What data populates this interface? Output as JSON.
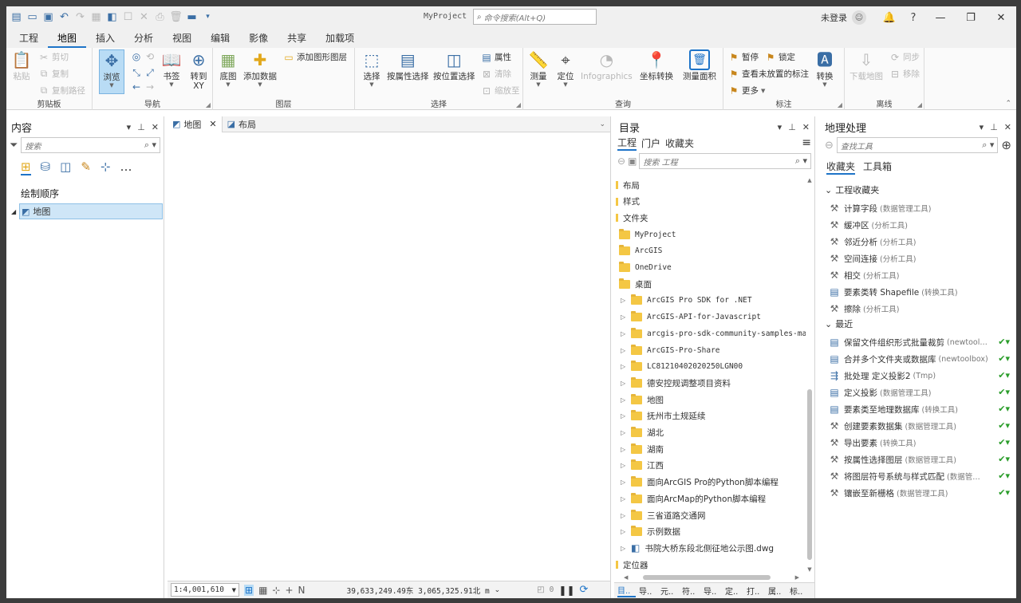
{
  "app": {
    "title": "MyProject",
    "command_search_placeholder": "命令搜索(Alt+Q)",
    "login": "未登录"
  },
  "tabs": [
    "工程",
    "地图",
    "插入",
    "分析",
    "视图",
    "编辑",
    "影像",
    "共享",
    "加载项"
  ],
  "active_tab": "地图",
  "ribbon": {
    "clipboard": {
      "label": "剪贴板",
      "paste": "粘贴",
      "cut": "剪切",
      "copy": "复制",
      "copy_path": "复制路径"
    },
    "navigate": {
      "label": "导航",
      "explore": "浏览",
      "bookmarks": "书签",
      "goto_xy": "转到\nXY"
    },
    "layer": {
      "label": "图层",
      "basemap": "底图",
      "add_data": "添加数据",
      "add_graphics_layer": "添加图形图层"
    },
    "selection": {
      "label": "选择",
      "select": "选择",
      "select_by_attr": "按属性选择",
      "select_by_loc": "按位置选择",
      "attributes": "属性",
      "clear": "清除",
      "zoom_to": "缩放至"
    },
    "inquiry": {
      "label": "查询",
      "measure": "测量",
      "locate": "定位",
      "infographics": "Infographics",
      "convert_coords": "坐标转换",
      "measure_area": "测量面积"
    },
    "labeling": {
      "label": "标注",
      "pause": "暂停",
      "lock": "锁定",
      "view_unplaced": "查看未放置的标注",
      "more": "更多",
      "convert": "转换"
    },
    "offline": {
      "label": "离线",
      "download_map": "下载地图",
      "sync": "同步",
      "remove": "移除"
    }
  },
  "contents": {
    "title": "内容",
    "search_placeholder": "搜索",
    "draw_order": "绘制顺序",
    "layer": "地图"
  },
  "map_tabs": [
    "地图",
    "布局"
  ],
  "status": {
    "scale": "1:4,001,610",
    "coords": "39,633,249.49东 3,065,325.91北 m",
    "selected": "0"
  },
  "catalog": {
    "title": "目录",
    "tabs": [
      "工程",
      "门户",
      "收藏夹"
    ],
    "search_placeholder": "搜索 工程",
    "items": [
      {
        "label": "布局",
        "level": 0,
        "type": "bar"
      },
      {
        "label": "样式",
        "level": 0,
        "type": "bar"
      },
      {
        "label": "文件夹",
        "level": 0,
        "type": "bar"
      },
      {
        "label": "MyProject",
        "level": 1,
        "type": "home"
      },
      {
        "label": "ArcGIS",
        "level": 1,
        "type": "folder"
      },
      {
        "label": "OneDrive",
        "level": 1,
        "type": "folder"
      },
      {
        "label": "桌面",
        "level": 1,
        "type": "folder"
      },
      {
        "label": "ArcGIS Pro SDK for .NET",
        "level": 2,
        "type": "folder"
      },
      {
        "label": "ArcGIS-API-for-Javascript",
        "level": 2,
        "type": "folder"
      },
      {
        "label": "arcgis-pro-sdk-community-samples-ma",
        "level": 2,
        "type": "folder"
      },
      {
        "label": "ArcGIS-Pro-Share",
        "level": 2,
        "type": "folder"
      },
      {
        "label": "LC81210402020250LGN00",
        "level": 2,
        "type": "folder"
      },
      {
        "label": "德安控规调整项目资料",
        "level": 2,
        "type": "folder"
      },
      {
        "label": "地图",
        "level": 2,
        "type": "folder"
      },
      {
        "label": "抚州市土规延续",
        "level": 2,
        "type": "folder"
      },
      {
        "label": "湖北",
        "level": 2,
        "type": "folder"
      },
      {
        "label": "湖南",
        "level": 2,
        "type": "folder"
      },
      {
        "label": "江西",
        "level": 2,
        "type": "folder"
      },
      {
        "label": "面向ArcGIS Pro的Python脚本编程",
        "level": 2,
        "type": "folder"
      },
      {
        "label": "面向ArcMap的Python脚本编程",
        "level": 2,
        "type": "folder"
      },
      {
        "label": "三省道路交通网",
        "level": 2,
        "type": "folder"
      },
      {
        "label": "示例数据",
        "level": 2,
        "type": "folder"
      },
      {
        "label": "书院大桥东段北侧征地公示图.dwg",
        "level": 2,
        "type": "dwg"
      },
      {
        "label": "定位器",
        "level": 0,
        "type": "bar"
      }
    ],
    "bottom_tabs": [
      "目..",
      "导..",
      "元..",
      "符..",
      "导..",
      "定..",
      "打..",
      "属..",
      "标.."
    ]
  },
  "geoprocessing": {
    "title": "地理处理",
    "search_placeholder": "查找工具",
    "tabs": [
      "收藏夹",
      "工具箱"
    ],
    "favorites_header": "工程收藏夹",
    "favorites": [
      {
        "name": "计算字段",
        "box": "(数据管理工具)",
        "icon": "hammer"
      },
      {
        "name": "缓冲区",
        "box": "(分析工具)",
        "icon": "hammer"
      },
      {
        "name": "邻近分析",
        "box": "(分析工具)",
        "icon": "hammer"
      },
      {
        "name": "空间连接",
        "box": "(分析工具)",
        "icon": "hammer"
      },
      {
        "name": "相交",
        "box": "(分析工具)",
        "icon": "hammer"
      },
      {
        "name": "要素类转 Shapefile",
        "box": "(转换工具)",
        "icon": "script"
      },
      {
        "name": "擦除",
        "box": "(分析工具)",
        "icon": "hammer"
      }
    ],
    "recent_header": "最近",
    "recent": [
      {
        "name": "保留文件组织形式批量裁剪",
        "box": "(newtool…",
        "icon": "script"
      },
      {
        "name": "合并多个文件夹或数据库",
        "box": "(newtoolbox)",
        "icon": "script"
      },
      {
        "name": "批处理 定义投影2",
        "box": "(Tmp)",
        "icon": "batch"
      },
      {
        "name": "定义投影",
        "box": "(数据管理工具)",
        "icon": "script"
      },
      {
        "name": "要素类至地理数据库",
        "box": "(转换工具)",
        "icon": "script"
      },
      {
        "name": "创建要素数据集",
        "box": "(数据管理工具)",
        "icon": "hammer"
      },
      {
        "name": "导出要素",
        "box": "(转换工具)",
        "icon": "hammer"
      },
      {
        "name": "按属性选择图层",
        "box": "(数据管理工具)",
        "icon": "hammer"
      },
      {
        "name": "将图层符号系统与样式匹配",
        "box": "(数据管…",
        "icon": "hammer"
      },
      {
        "name": "镶嵌至新栅格",
        "box": "(数据管理工具)",
        "icon": "hammer"
      }
    ]
  },
  "colors": {
    "accent": "#1e74c8",
    "folder": "#f4c744",
    "success": "#2a9d2a"
  }
}
